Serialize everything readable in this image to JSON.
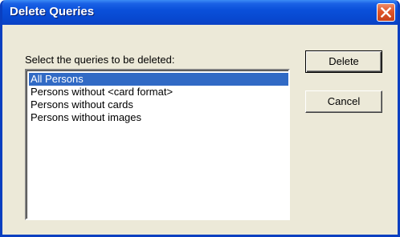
{
  "window": {
    "title": "Delete Queries"
  },
  "dialog": {
    "prompt": "Select the queries to be deleted:",
    "queries": [
      {
        "label": "All Persons",
        "selected": true
      },
      {
        "label": "Persons without <card format>",
        "selected": false
      },
      {
        "label": "Persons without cards",
        "selected": false
      },
      {
        "label": "Persons without images",
        "selected": false
      }
    ],
    "delete_label": "Delete",
    "cancel_label": "Cancel"
  },
  "colors": {
    "title_bar": "#0a50da",
    "selection": "#316ac5",
    "dialog_bg": "#ece9d8",
    "close_button": "#e05528"
  },
  "icons": {
    "close": "close-icon"
  }
}
